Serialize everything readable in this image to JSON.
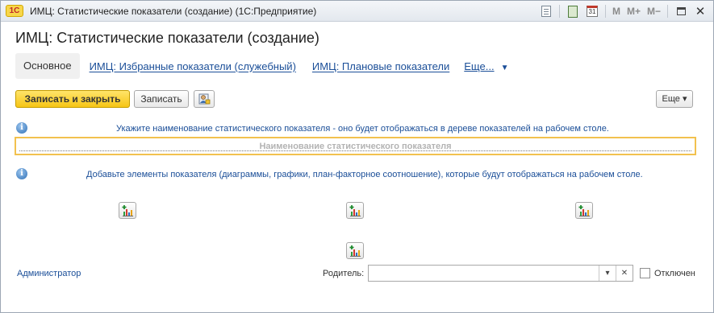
{
  "window": {
    "title": "ИМЦ: Статистические показатели (создание)  (1С:Предприятие)",
    "logo_text": "1С",
    "toolbar": {
      "m": "M",
      "m_plus": "M+",
      "m_minus": "M−"
    }
  },
  "form": {
    "title": "ИМЦ: Статистические показатели (создание)",
    "tabs": [
      {
        "label": "Основное"
      },
      {
        "label": "ИМЦ: Избранные показатели (служебный)"
      },
      {
        "label": "ИМЦ: Плановые показатели"
      }
    ],
    "tabs_more": "Еще...",
    "commands": {
      "save_close": "Записать и закрыть",
      "save": "Записать",
      "more": "Еще ▾"
    },
    "info_name": "Укажите наименование статистического показателя - оно будет отображаться в дереве показателей на рабочем столе.",
    "name_placeholder": "Наименование статистического показателя",
    "name_value": "",
    "info_elements": "Добавьте элементы показателя (диаграммы, графики, план-факторное соотношение), которые будут отображаться на рабочем столе.",
    "footer": {
      "author": "Администратор",
      "parent_label": "Родитель:",
      "parent_value": "",
      "disabled_label": "Отключен"
    }
  },
  "icons": {
    "info": "info-icon",
    "add_element": "add-chart-icon",
    "access": "user-access-icon"
  },
  "colors": {
    "accent": "#1a4e98",
    "primary_button": "#f6c516",
    "highlight_border": "#f2c14e"
  }
}
